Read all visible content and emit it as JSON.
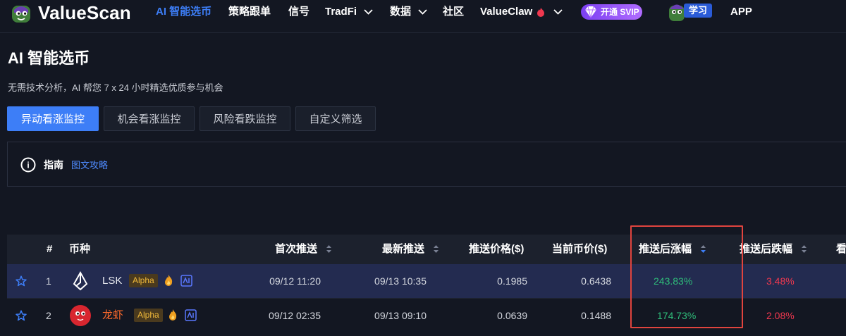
{
  "nav": {
    "brand": "ValueScan",
    "items": [
      {
        "label": "AI 智能选币",
        "active": true
      },
      {
        "label": "策略跟单"
      },
      {
        "label": "信号"
      },
      {
        "label": "TradFi",
        "dropdown": true
      },
      {
        "label": "数据",
        "dropdown": true
      },
      {
        "label": "社区"
      },
      {
        "label": "ValueClaw",
        "dropdown": true
      }
    ],
    "svip_label": "开通 SVIP",
    "learn_label": "学习",
    "app_label": "APP"
  },
  "page": {
    "title": "AI 智能选币",
    "subtitle": "无需技术分析，AI 帮您 7 x 24 小时精选优质参与机会"
  },
  "tabs": [
    {
      "label": "异动看涨监控",
      "active": true
    },
    {
      "label": "机会看涨监控"
    },
    {
      "label": "风险看跌监控"
    },
    {
      "label": "自定义筛选"
    }
  ],
  "guide": {
    "title": "指南",
    "link": "图文攻略"
  },
  "table": {
    "headers": {
      "index": "#",
      "coin": "币种",
      "first_push": "首次推送",
      "latest_push": "最新推送",
      "push_price": "推送价格($)",
      "current_price": "当前币价($)",
      "gain_after": "推送后涨幅",
      "drop_after": "推送后跌幅",
      "more": "看"
    },
    "rows": [
      {
        "index": "1",
        "coin": "LSK",
        "badge": "Alpha",
        "first_push": "09/12 11:20",
        "latest_push": "09/13 10:35",
        "push_price": "0.1985",
        "current_price": "0.6438",
        "gain_after": "243.83%",
        "drop_after": "3.48%"
      },
      {
        "index": "2",
        "coin": "龙虾",
        "badge": "Alpha",
        "first_push": "09/12 02:35",
        "latest_push": "09/13 09:10",
        "push_price": "0.0639",
        "current_price": "0.1488",
        "gain_after": "174.73%",
        "drop_after": "2.08%"
      }
    ]
  },
  "colors": {
    "accent": "#3d7ef7",
    "positive": "#2fbd7a",
    "negative": "#f0384f",
    "alpha_badge": "#f0b93a",
    "highlight_box": "#e0443e",
    "coin2_name": "#ff6a2b"
  },
  "icons": [
    "valuescan-logo-icon",
    "chevron-down-icon",
    "gem-icon",
    "mascot-icon",
    "info-circle-icon",
    "sort-icon",
    "star-icon",
    "lsk-logo-icon",
    "lobster-logo-icon",
    "fire-icon",
    "ai-badge-icon"
  ]
}
